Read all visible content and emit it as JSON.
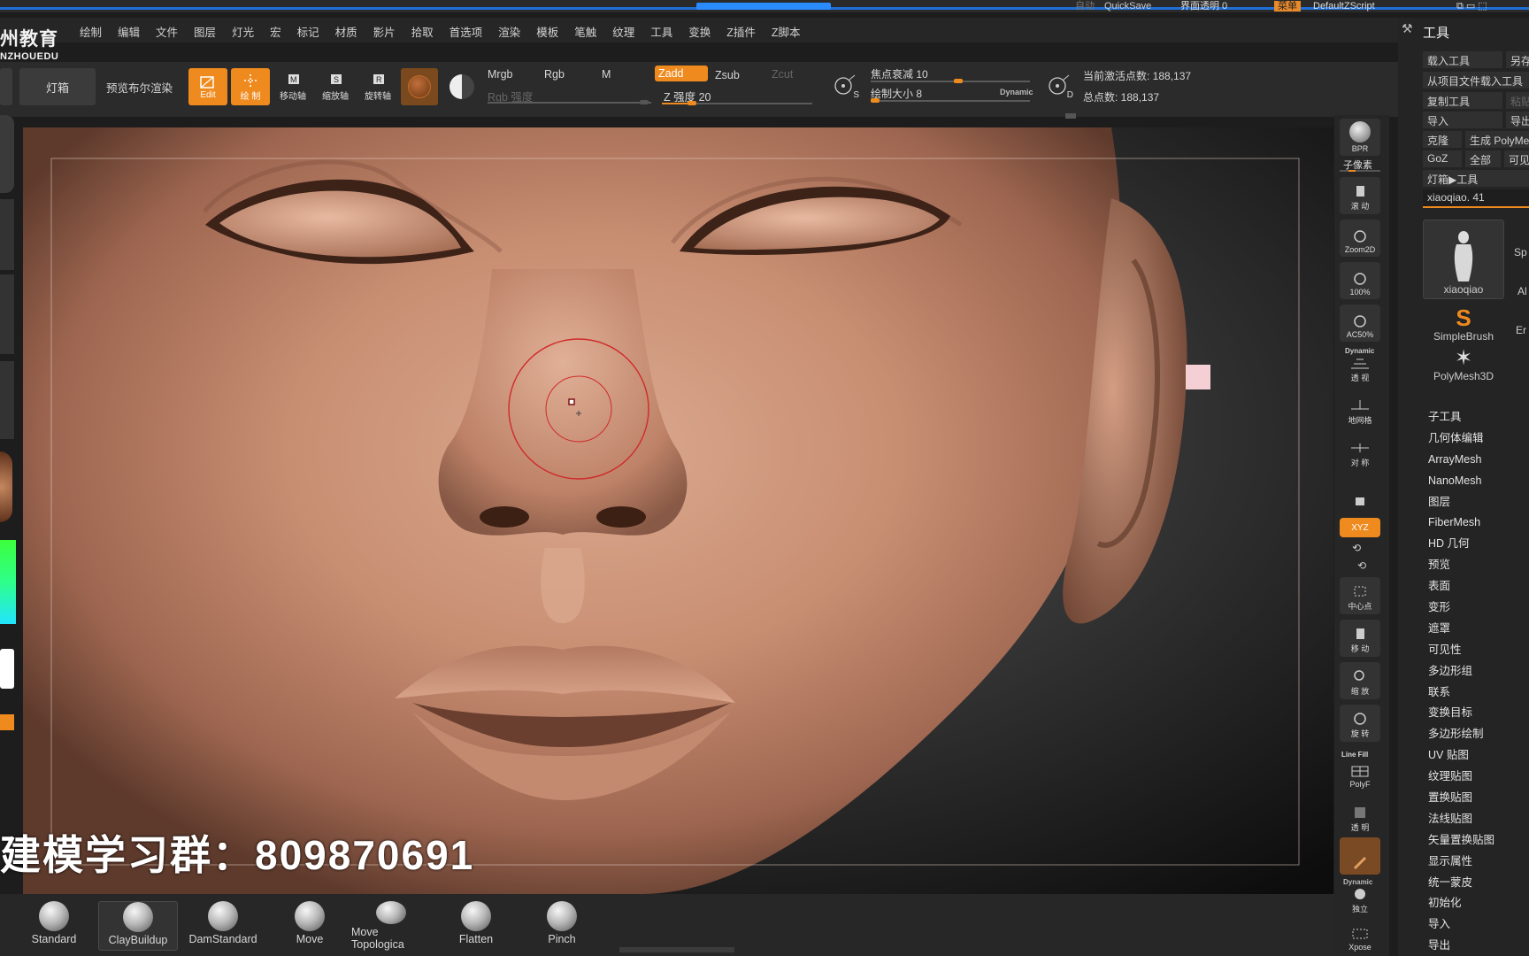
{
  "topbar": {
    "quicksave": "QuickSave",
    "interface_opacity": "界面透明 0",
    "menu_label": "菜单",
    "script": "DefaultZScript",
    "faint_left": "自动"
  },
  "logo": {
    "line1": "州教育",
    "line2": "NZHOUEDU"
  },
  "menubar": {
    "items": [
      "绘制",
      "编辑",
      "文件",
      "图层",
      "灯光",
      "宏",
      "标记",
      "材质",
      "影片",
      "拾取",
      "首选项",
      "渲染",
      "模板",
      "笔触",
      "纹理",
      "工具",
      "变换",
      "Z插件",
      "Z脚本"
    ]
  },
  "toolbar": {
    "lightbox": "灯箱",
    "preview_bpr": "预览布尔渲染",
    "edit": "Edit",
    "draw": "绘 制",
    "move": "移动轴",
    "scale": "缩放轴",
    "rotate": "旋转轴",
    "mrgb": "Mrgb",
    "rgb": "Rgb",
    "m": "M",
    "rgb_intensity": "Rgb 强度",
    "zadd": "Zadd",
    "zsub": "Zsub",
    "zcut": "Zcut",
    "z_intensity": "Z 强度 20",
    "focal_shift": "焦点衰减 10",
    "draw_size": "绘制大小 8",
    "dynamic": "Dynamic",
    "active_points": "当前激活点数: 188,137",
    "total_points": "总点数: 188,137",
    "s_label": "S",
    "d_label": "D",
    "z_intensity_value": 20,
    "focal_shift_value": 10,
    "draw_size_value": 8
  },
  "watermark": "建模学习群：809870691",
  "brushes": [
    {
      "name": "Standard"
    },
    {
      "name": "ClayBuildup"
    },
    {
      "name": "DamStandard"
    },
    {
      "name": "Move"
    },
    {
      "name": "Move Topologica"
    },
    {
      "name": "Flatten"
    },
    {
      "name": "Pinch"
    }
  ],
  "right_shelf": {
    "bpr": "BPR",
    "subpixel": "子像素",
    "scroll": "滚 动",
    "zoom2d": "Zoom2D",
    "p100": "100%",
    "ac50": "AC50%",
    "dynamic": "Dynamic",
    "persp": "透 视",
    "floor": "地网格",
    "symmetry": "对 称",
    "xyz": "XYZ",
    "center": "中心点",
    "move": "移 动",
    "zoom": "缩 放",
    "rotate": "旋 转",
    "linefill": "Line Fill",
    "polyf": "PolyF",
    "transp": "透 明",
    "solo": "独立",
    "xpose": "Xpose",
    "dynamic2": "Dynamic"
  },
  "tool_panel": {
    "title": "工具",
    "load_tool": "载入工具",
    "save_as": "另存",
    "load_from_project": "从项目文件载入工具",
    "copy_tool": "复制工具",
    "paste": "粘贴",
    "import": "导入",
    "export": "导出",
    "clone": "克隆",
    "make_polymesh": "生成 PolyMesh",
    "goz": "GoZ",
    "all": "全部",
    "visible": "可见",
    "lightbox_tool": "灯箱▶工具",
    "current_tool": "xiaoqiao. 41",
    "thumbs": [
      {
        "name": "xiaoqiao"
      },
      {
        "name": "SimpleBrush"
      },
      {
        "name": "PolyMesh3D"
      }
    ],
    "side_thumbs": [
      "Sp",
      "Al",
      "Er"
    ],
    "subpalettes": [
      "子工具",
      "几何体编辑",
      "ArrayMesh",
      "NanoMesh",
      "图层",
      "FiberMesh",
      "HD 几何",
      "预览",
      "表面",
      "变形",
      "遮罩",
      "可见性",
      "多边形组",
      "联系",
      "变换目标",
      "多边形绘制",
      "UV 贴图",
      "纹理贴图",
      "置换贴图",
      "法线贴图",
      "矢量置换贴图",
      "显示属性",
      "统一蒙皮",
      "初始化",
      "导入",
      "导出"
    ]
  },
  "colors": {
    "accent": "#ef8a1f",
    "skin_light": "#d8a48b",
    "skin_mid": "#b77a60",
    "skin_dark": "#7e4d3c",
    "brush_ring": "#d02a2a"
  }
}
